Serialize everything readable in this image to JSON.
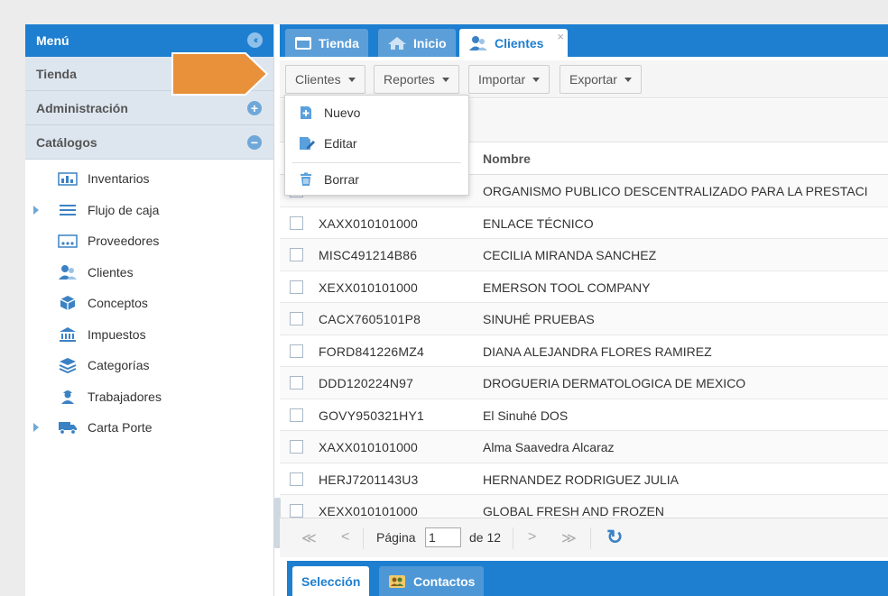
{
  "menu": {
    "title": "Menú",
    "sections": [
      {
        "label": "Tienda"
      },
      {
        "label": "Administración"
      },
      {
        "label": "Catálogos"
      }
    ],
    "items": [
      {
        "label": "Inventarios",
        "icon": "inventory-icon",
        "expandable": false
      },
      {
        "label": "Flujo de caja",
        "icon": "lines-icon",
        "expandable": true
      },
      {
        "label": "Proveedores",
        "icon": "suppliers-icon",
        "expandable": false
      },
      {
        "label": "Clientes",
        "icon": "clients-icon",
        "expandable": false
      },
      {
        "label": "Conceptos",
        "icon": "box-icon",
        "expandable": false
      },
      {
        "label": "Impuestos",
        "icon": "bank-icon",
        "expandable": false
      },
      {
        "label": "Categorías",
        "icon": "layers-icon",
        "expandable": false
      },
      {
        "label": "Trabajadores",
        "icon": "worker-icon",
        "expandable": false
      },
      {
        "label": "Carta Porte",
        "icon": "truck-icon",
        "expandable": true
      }
    ]
  },
  "tabs": [
    {
      "label": "Tienda",
      "icon": "store-icon"
    },
    {
      "label": "Inicio",
      "icon": "home-icon"
    },
    {
      "label": "Clientes",
      "icon": "clients-icon",
      "close": "×"
    }
  ],
  "toolbar": {
    "clientes": "Clientes",
    "reportes": "Reportes",
    "importar": "Importar",
    "exportar": "Exportar"
  },
  "dropdown": {
    "nuevo": "Nuevo",
    "editar": "Editar",
    "borrar": "Borrar"
  },
  "grid": {
    "column_name": "Nombre",
    "rows": [
      {
        "rfc": "",
        "name": "ORGANISMO PUBLICO DESCENTRALIZADO PARA LA PRESTACI"
      },
      {
        "rfc": "XAXX010101000",
        "name": "ENLACE TÉCNICO"
      },
      {
        "rfc": "MISC491214B86",
        "name": "CECILIA MIRANDA SANCHEZ"
      },
      {
        "rfc": "XEXX010101000",
        "name": "EMERSON TOOL COMPANY"
      },
      {
        "rfc": "CACX7605101P8",
        "name": "SINUHÉ PRUEBAS"
      },
      {
        "rfc": "FORD841226MZ4",
        "name": "DIANA ALEJANDRA FLORES RAMIREZ"
      },
      {
        "rfc": "DDD120224N97",
        "name": "DROGUERIA DERMATOLOGICA DE MEXICO"
      },
      {
        "rfc": "GOVY950321HY1",
        "name": "El Sinuhé DOS"
      },
      {
        "rfc": "XAXX010101000",
        "name": "Alma Saavedra Alcaraz"
      },
      {
        "rfc": "HERJ7201143U3",
        "name": "HERNANDEZ RODRIGUEZ JULIA"
      },
      {
        "rfc": "XEXX010101000",
        "name": "GLOBAL FRESH AND FROZEN"
      }
    ]
  },
  "pager": {
    "first": "≪",
    "prev": "<",
    "page_label": "Página",
    "page_value": "1",
    "of_label": "de 12",
    "next": ">",
    "last": "≫",
    "refresh": "↻"
  },
  "bottom_tabs": [
    {
      "label": "Selección"
    },
    {
      "label": "Contactos",
      "icon": "contacts-icon"
    }
  ],
  "colors": {
    "accent": "#1e7fd0",
    "arrow": "#e8903a"
  }
}
